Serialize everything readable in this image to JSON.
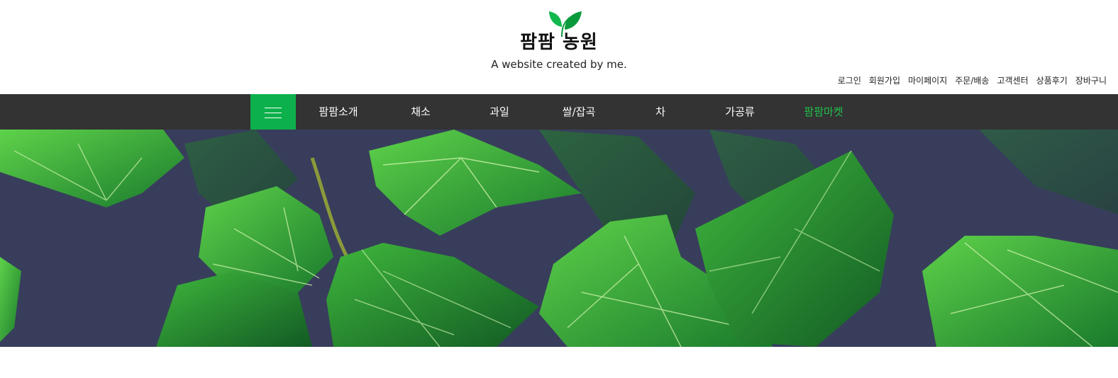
{
  "header": {
    "logo_title": "팜팜 농원",
    "logo_subtitle": "A website created by me."
  },
  "util_links": [
    "로그인",
    "회원가입",
    "마이페이지",
    "주문/배송",
    "고객센터",
    "상품후기",
    "장바구니"
  ],
  "nav": {
    "menu_icon": "hamburger-icon",
    "items": [
      "팜팜소개",
      "채소",
      "과일",
      "쌀/잡곡",
      "차",
      "가공류",
      "팜팜마켓"
    ]
  },
  "colors": {
    "accent": "#0db14b",
    "nav_bg": "#333333",
    "highlight": "#20c04a",
    "hero_bg": "#383d5c"
  }
}
